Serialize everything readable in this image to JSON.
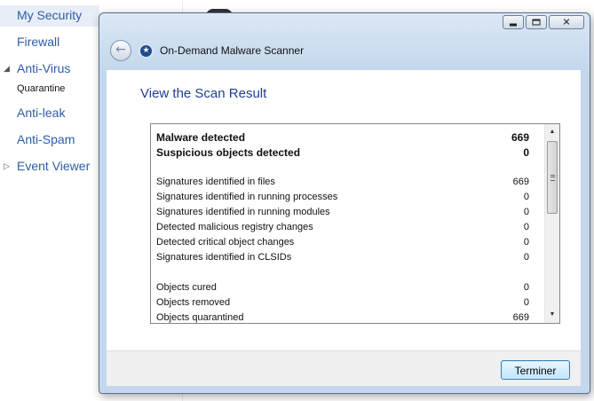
{
  "sidebar": {
    "items": [
      {
        "label": "My Security"
      },
      {
        "label": "Firewall"
      },
      {
        "label": "Anti-Virus",
        "expanded": true,
        "children": [
          {
            "label": "Quarantine"
          }
        ]
      },
      {
        "label": "Anti-leak"
      },
      {
        "label": "Anti-Spam"
      },
      {
        "label": "Event Viewer",
        "expandable": true
      }
    ]
  },
  "window": {
    "title": "On-Demand Malware Scanner",
    "heading": "View the Scan Result",
    "controls": {
      "minimize": "minimize",
      "maximize": "maximize",
      "close": "close"
    }
  },
  "results": {
    "summary": [
      {
        "label": "Malware detected",
        "value": "669"
      },
      {
        "label": "Suspicious objects detected",
        "value": "0"
      }
    ],
    "signatures": [
      {
        "label": "Signatures identified in files",
        "value": "669"
      },
      {
        "label": "Signatures identified in running processes",
        "value": "0"
      },
      {
        "label": "Signatures identified in running modules",
        "value": "0"
      },
      {
        "label": "Detected malicious registry changes",
        "value": "0"
      },
      {
        "label": "Detected critical object changes",
        "value": "0"
      },
      {
        "label": "Signatures identified in CLSIDs",
        "value": "0"
      }
    ],
    "objects": [
      {
        "label": "Objects cured",
        "value": "0"
      },
      {
        "label": "Objects removed",
        "value": "0"
      },
      {
        "label": "Objects quarantined",
        "value": "669"
      }
    ]
  },
  "footer": {
    "finish_label": "Terminer"
  },
  "colors": {
    "accent": "#1e3f8c",
    "link": "#2c5da8",
    "frame": "#c4d7ec"
  }
}
